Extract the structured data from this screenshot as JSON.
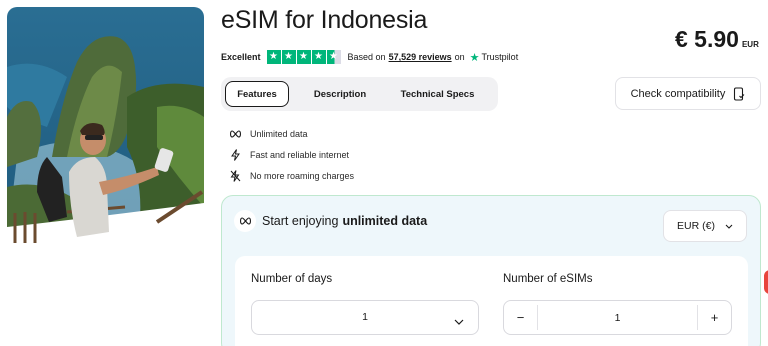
{
  "product": {
    "title": "eSIM for Indonesia",
    "price": "€ 5.90",
    "currency_code": "EUR"
  },
  "rating": {
    "label": "Excellent",
    "stars": 4.5,
    "based_on": "Based on",
    "reviews": "57,529 reviews",
    "on": "on",
    "platform": "Trustpilot"
  },
  "tabs": [
    "Features",
    "Description",
    "Technical Specs"
  ],
  "compatibility_button": "Check compatibility",
  "features": [
    {
      "icon": "infinity-icon",
      "label": "Unlimited data"
    },
    {
      "icon": "lightning-icon",
      "label": "Fast and reliable internet"
    },
    {
      "icon": "no-roaming-icon",
      "label": "No more roaming charges"
    }
  ],
  "plan": {
    "heading_prefix": "Start enjoying",
    "heading_bold": "unlimited data",
    "currency_select": "EUR (€)",
    "days_label": "Number of days",
    "days_value": "1",
    "esims_label": "Number of eSIMs",
    "esims_value": "1",
    "minus": "−",
    "plus": "+"
  },
  "colors": {
    "trustpilot_green": "#00b67a",
    "panel_bg": "#eef7fb",
    "panel_border": "#bfe8cf"
  }
}
